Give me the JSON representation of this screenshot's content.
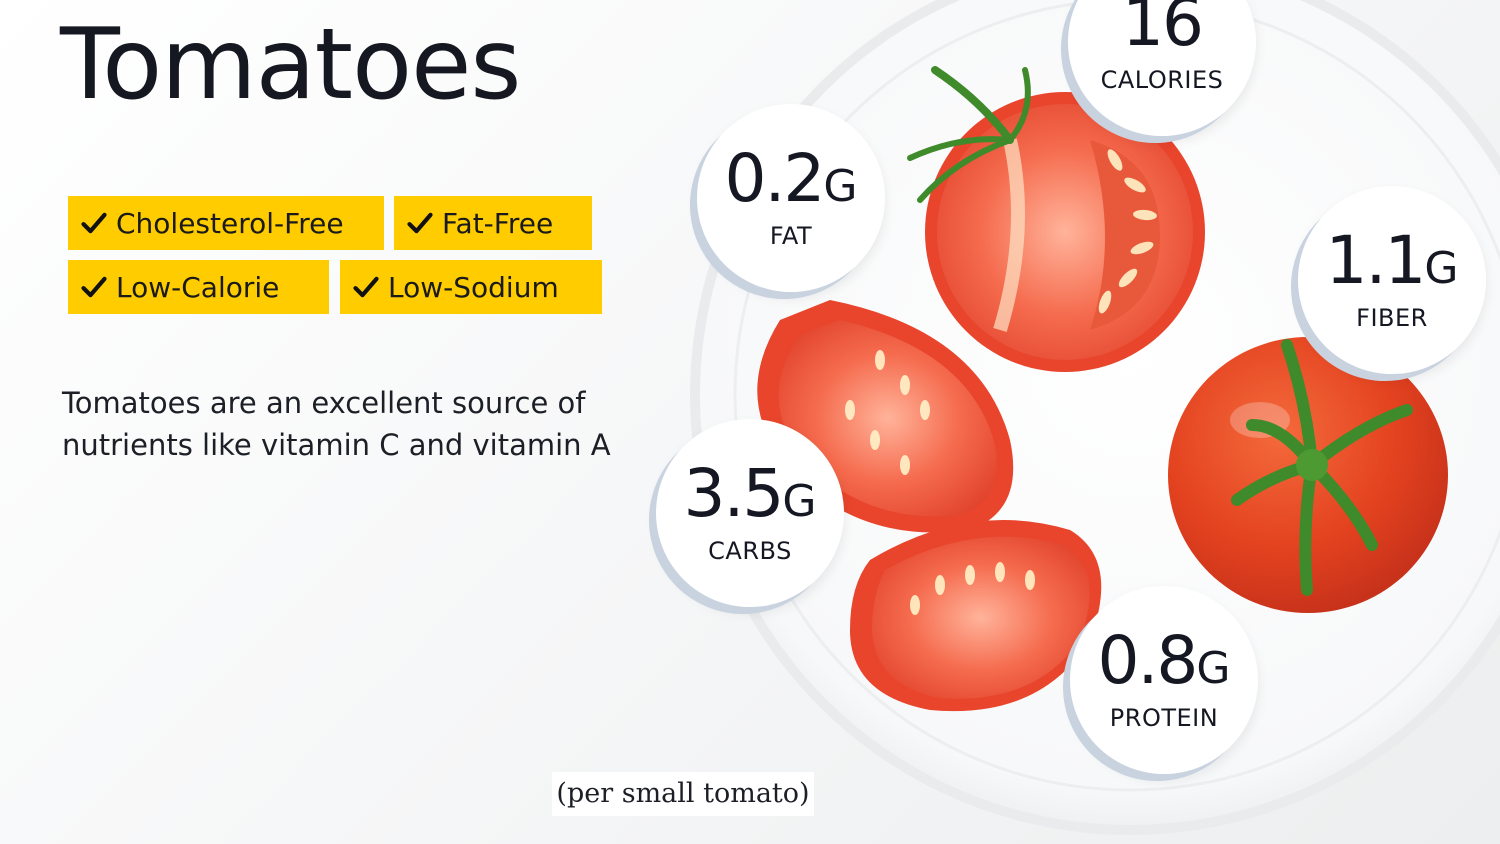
{
  "title": "Tomatoes",
  "tags": [
    {
      "label": "Cholesterol-Free"
    },
    {
      "label": "Fat-Free"
    },
    {
      "label": "Low-Calorie"
    },
    {
      "label": "Low-Sodium"
    }
  ],
  "description": "Tomatoes are an excellent source of nutrients like vitamin C and vitamin A",
  "footnote": "(per small tomato)",
  "nutrients": {
    "calories": {
      "value": "16",
      "unit": "",
      "label": "CALORIES"
    },
    "fat": {
      "value": "0.2",
      "unit": "G",
      "label": "FAT"
    },
    "fiber": {
      "value": "1.1",
      "unit": "G",
      "label": "FIBER"
    },
    "carbs": {
      "value": "3.5",
      "unit": "G",
      "label": "CARBS"
    },
    "protein": {
      "value": "0.8",
      "unit": "G",
      "label": "PROTEIN"
    }
  },
  "colors": {
    "tag_bg": "#ffcc00",
    "badge_shadow": "#c9d3e0",
    "tomato_red": "#e8452c",
    "tomato_flesh": "#f26a4c",
    "stem_green": "#3f8a2a"
  },
  "icons": {
    "check": "check-icon"
  }
}
